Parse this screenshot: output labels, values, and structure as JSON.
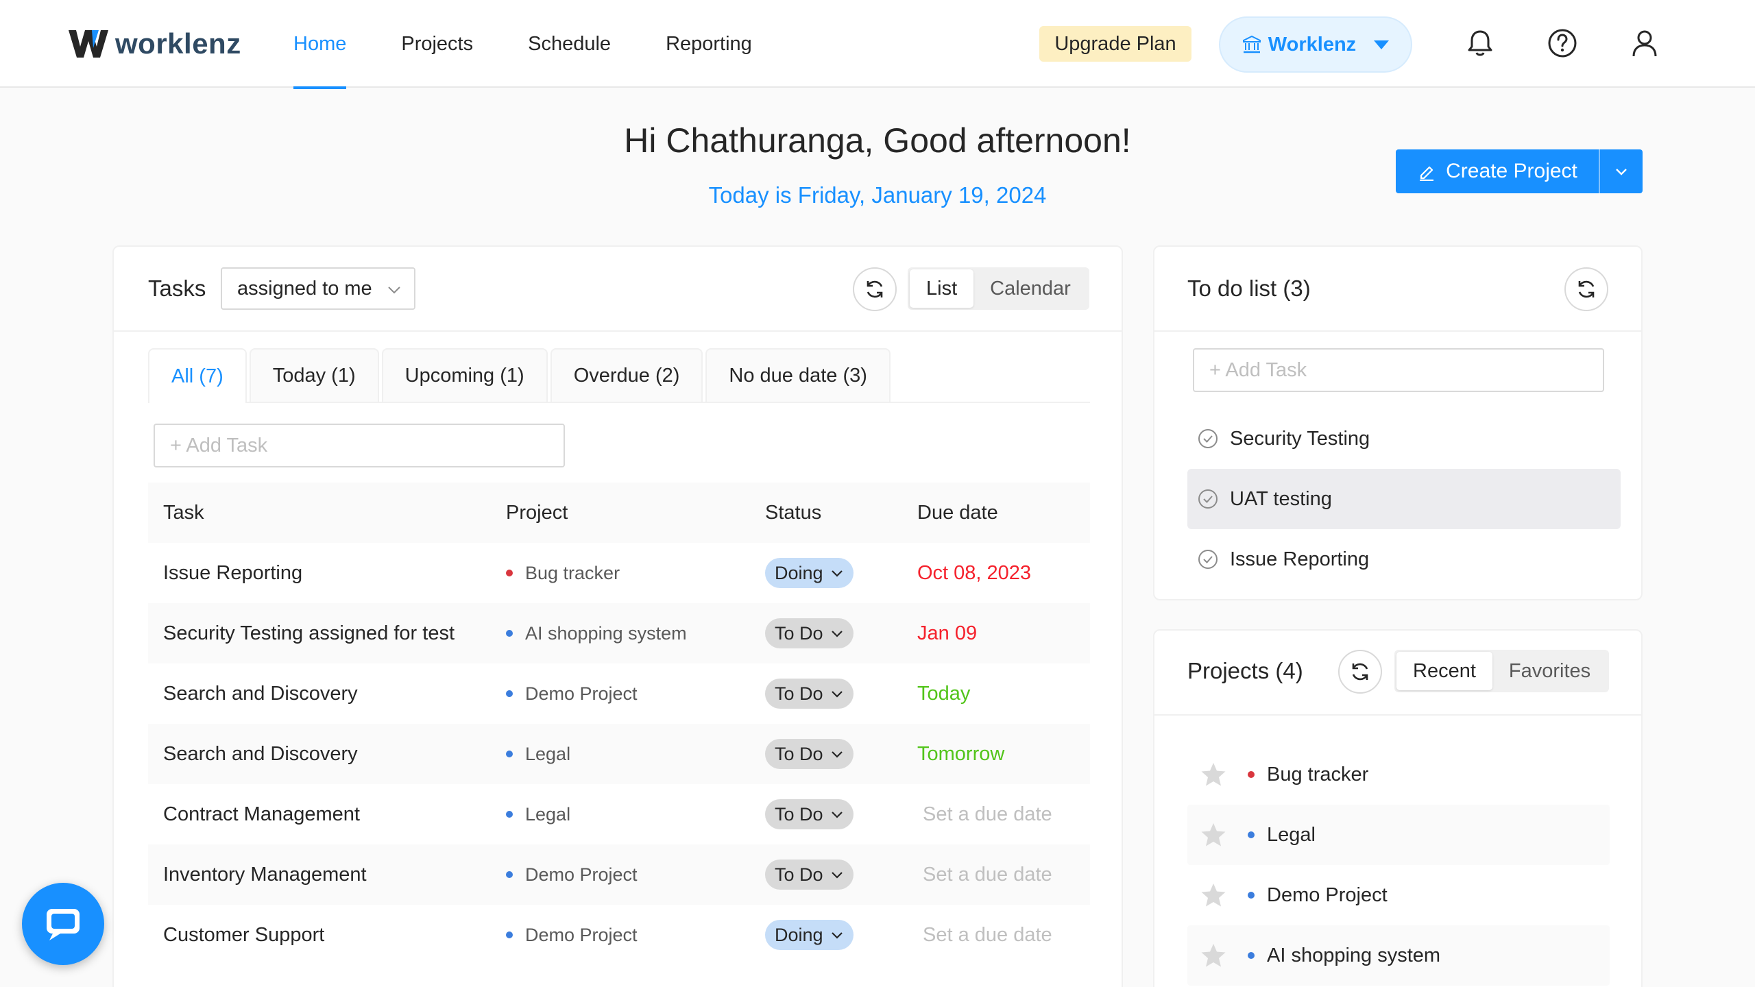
{
  "brand": {
    "name": "worklenz"
  },
  "nav": [
    {
      "label": "Home",
      "active": true
    },
    {
      "label": "Projects",
      "active": false
    },
    {
      "label": "Schedule",
      "active": false
    },
    {
      "label": "Reporting",
      "active": false
    }
  ],
  "header": {
    "upgrade_label": "Upgrade Plan",
    "org_label": "Worklenz",
    "icons": [
      "bell-icon",
      "help-icon",
      "user-icon"
    ]
  },
  "greeting": {
    "title": "Hi Chathuranga, Good afternoon!",
    "date_line": "Today is Friday, January 19, 2024"
  },
  "create_project": {
    "label": "Create Project"
  },
  "tasks": {
    "title": "Tasks",
    "filter": "assigned to me",
    "view_list": "List",
    "view_calendar": "Calendar",
    "tabs": [
      "All (7)",
      "Today (1)",
      "Upcoming (1)",
      "Overdue (2)",
      "No due date (3)"
    ],
    "add_placeholder": "+ Add Task",
    "columns": {
      "task": "Task",
      "project": "Project",
      "status": "Status",
      "due": "Due date"
    },
    "rows": [
      {
        "task": "Issue Reporting",
        "project": "Bug tracker",
        "project_color": "#d9363e",
        "status": "Doing",
        "due": "Oct 08, 2023",
        "due_state": "late"
      },
      {
        "task": "Security Testing assigned for test",
        "project": "AI shopping system",
        "project_color": "#3b7ddd",
        "status": "To Do",
        "due": "Jan 09",
        "due_state": "late"
      },
      {
        "task": "Search and Discovery",
        "project": "Demo Project",
        "project_color": "#3b7ddd",
        "status": "To Do",
        "due": "Today",
        "due_state": "ok"
      },
      {
        "task": "Search and Discovery",
        "project": "Legal",
        "project_color": "#3b7ddd",
        "status": "To Do",
        "due": "Tomorrow",
        "due_state": "ok"
      },
      {
        "task": "Contract Management",
        "project": "Legal",
        "project_color": "#3b7ddd",
        "status": "To Do",
        "due": "Set a due date",
        "due_state": "none"
      },
      {
        "task": "Inventory Management",
        "project": "Demo Project",
        "project_color": "#3b7ddd",
        "status": "To Do",
        "due": "Set a due date",
        "due_state": "none"
      },
      {
        "task": "Customer Support",
        "project": "Demo Project",
        "project_color": "#3b7ddd",
        "status": "Doing",
        "due": "Set a due date",
        "due_state": "none"
      }
    ]
  },
  "todo": {
    "title": "To do list (3)",
    "add_placeholder": "+ Add Task",
    "items": [
      "Security Testing",
      "UAT testing",
      "Issue Reporting"
    ]
  },
  "projects": {
    "title": "Projects (4)",
    "view_recent": "Recent",
    "view_favorites": "Favorites",
    "items": [
      {
        "name": "Bug tracker",
        "color": "#d9363e"
      },
      {
        "name": "Legal",
        "color": "#3b7ddd"
      },
      {
        "name": "Demo Project",
        "color": "#3b7ddd"
      },
      {
        "name": "AI shopping system",
        "color": "#3b7ddd"
      }
    ]
  },
  "colors": {
    "accent": "#1890ff",
    "doing_bg": "#c5ddf8",
    "todo_bg": "#d9d9d9",
    "overdue": "#f5222d",
    "soon": "#52c41a"
  }
}
